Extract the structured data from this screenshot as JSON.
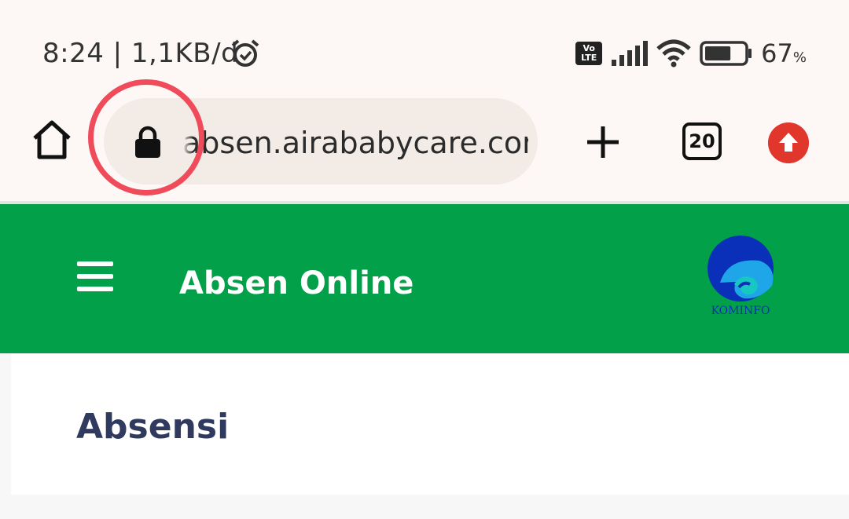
{
  "status_bar": {
    "time_speed": "8:24 | 1,1KB/d",
    "volte_line1": "Vo",
    "volte_line2": "LTE",
    "battery_percent": "67",
    "battery_unit": "%",
    "battery_level": 0.67,
    "icons": [
      "alarm-icon",
      "volte-icon",
      "signal-icon",
      "wifi-icon",
      "battery-icon"
    ]
  },
  "browser": {
    "url": "absen.airababycare.com",
    "tab_count": "20",
    "icons": [
      "home-icon",
      "lock-icon",
      "plus-icon",
      "tabs-icon",
      "update-icon"
    ],
    "highlight_color": "#f04b5a"
  },
  "app": {
    "title": "Absen Online",
    "logo_text": "KOMINFO",
    "header_color": "#03a04a",
    "section_title": "Absensi"
  }
}
